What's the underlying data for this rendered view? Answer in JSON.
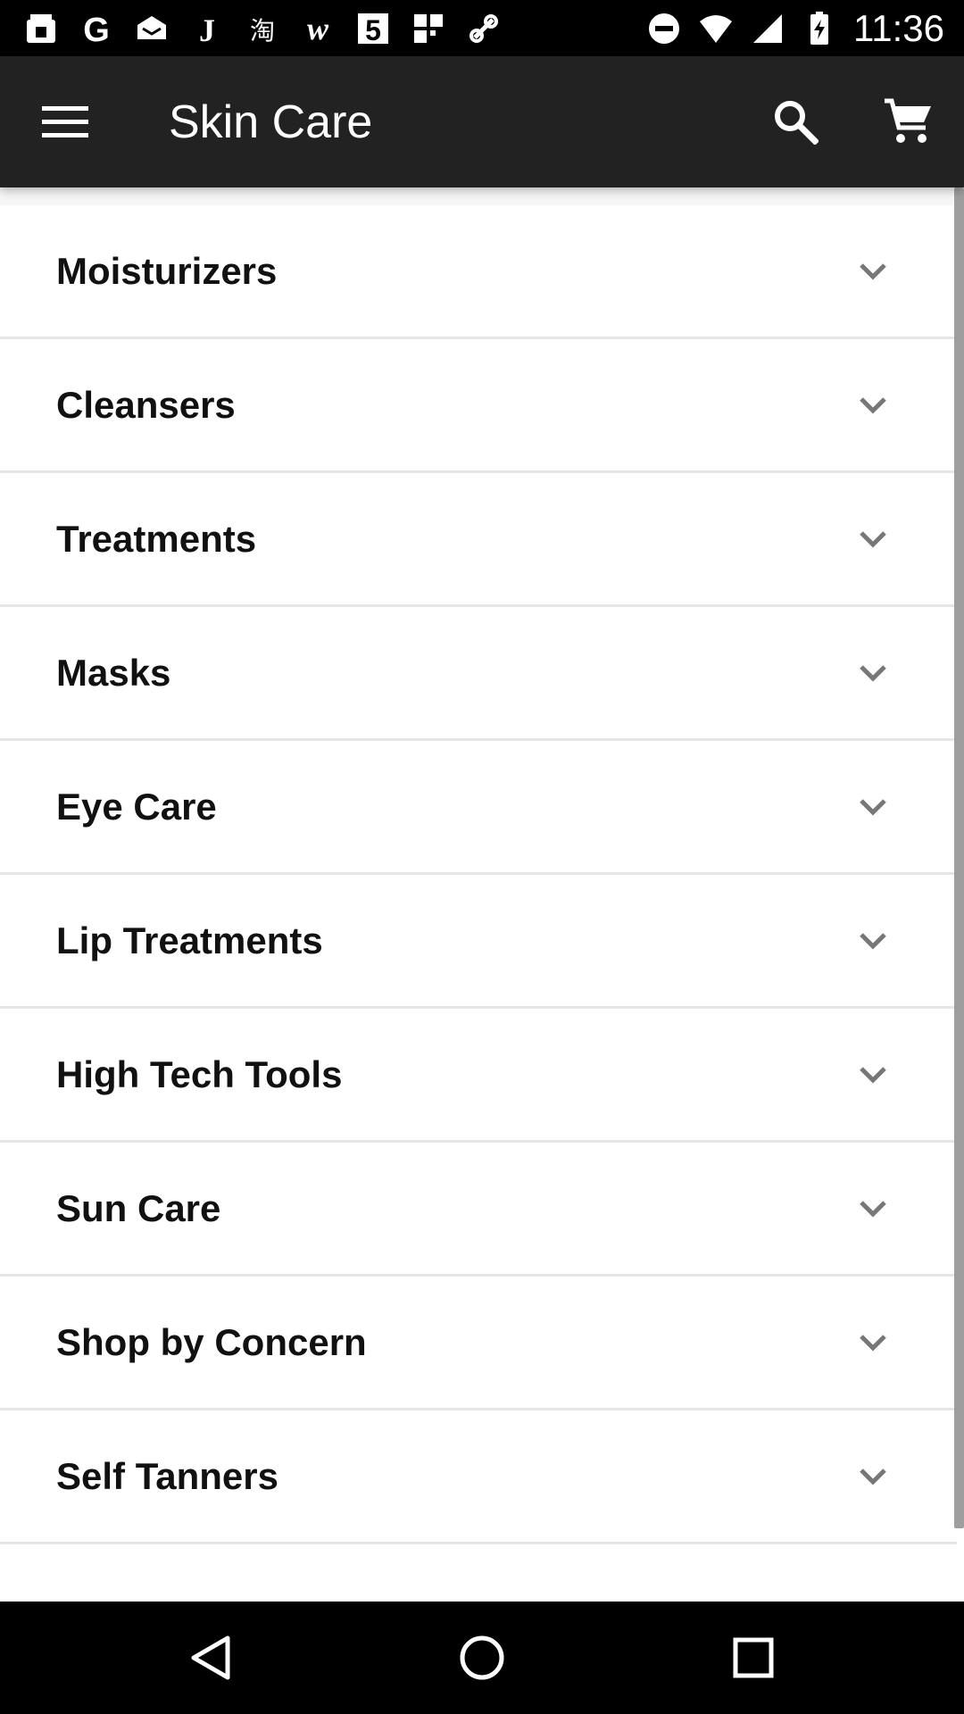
{
  "status_bar": {
    "time": "11:36",
    "left_icons": [
      "store-icon",
      "google-icon",
      "mail-icon",
      "j-icon",
      "taobao-icon",
      "w-icon",
      "five-icon",
      "grid-icon",
      "link-icon"
    ],
    "right_icons": [
      "do-not-disturb-icon",
      "wifi-icon",
      "signal-icon",
      "battery-charging-icon"
    ]
  },
  "app_bar": {
    "title": "Skin Care",
    "background": "#222222"
  },
  "categories": [
    {
      "label": "Moisturizers"
    },
    {
      "label": "Cleansers"
    },
    {
      "label": "Treatments"
    },
    {
      "label": "Masks"
    },
    {
      "label": "Eye Care"
    },
    {
      "label": "Lip Treatments"
    },
    {
      "label": "High Tech Tools"
    },
    {
      "label": "Sun Care"
    },
    {
      "label": "Shop by Concern"
    },
    {
      "label": "Self Tanners"
    }
  ],
  "nav_bar": {
    "buttons": [
      "back-icon",
      "home-icon",
      "recents-icon"
    ]
  }
}
